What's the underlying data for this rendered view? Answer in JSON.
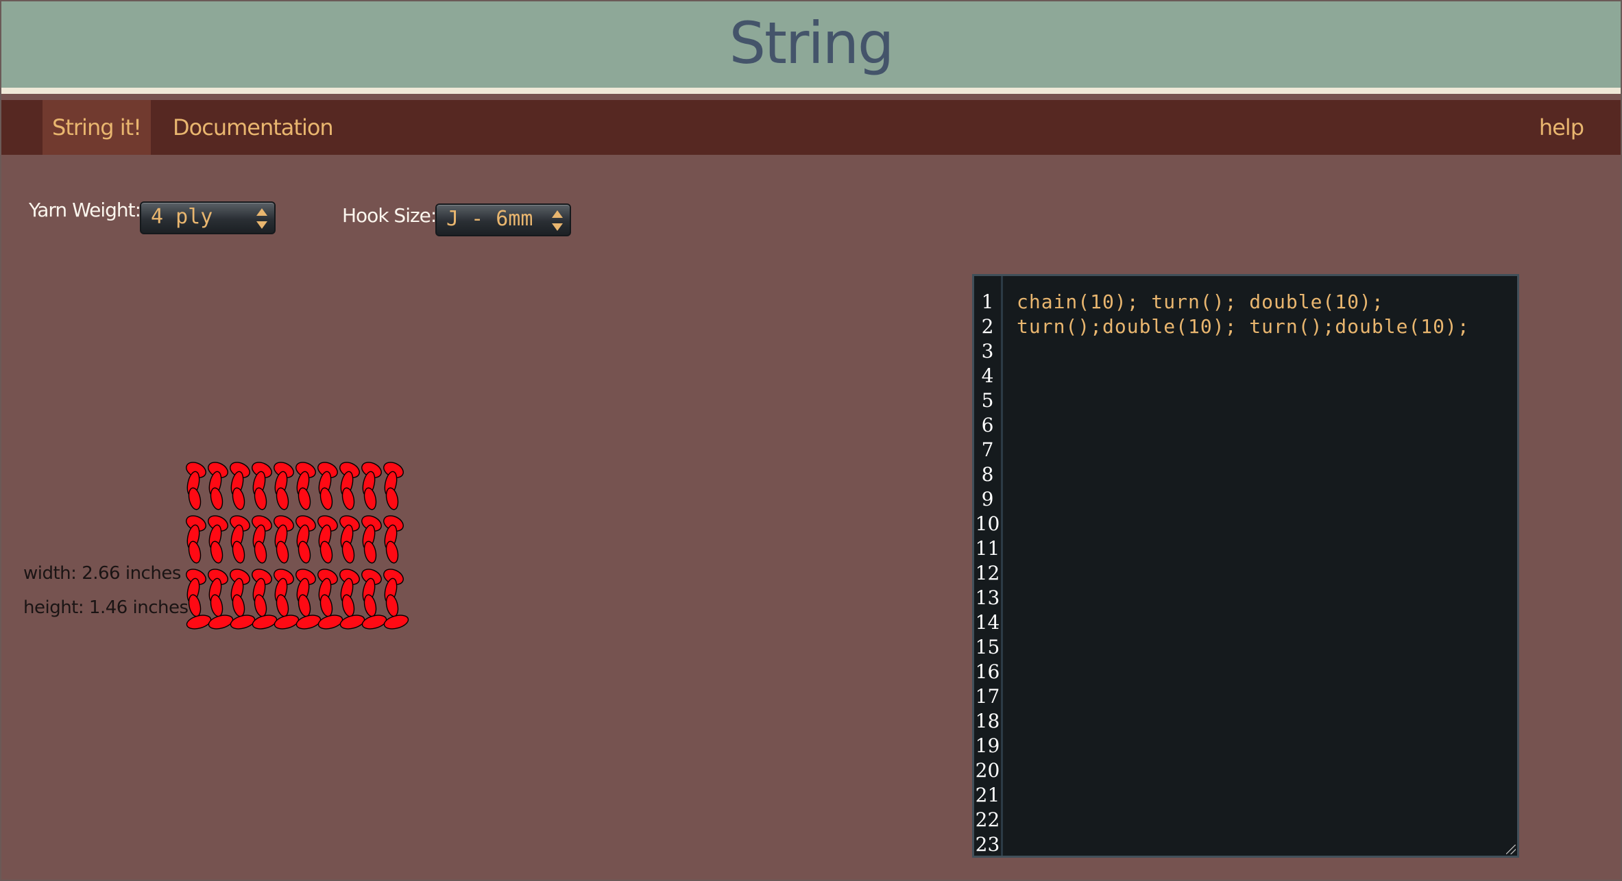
{
  "header": {
    "title": "String"
  },
  "nav": {
    "string_it": "String it!",
    "documentation": "Documentation",
    "help": "help"
  },
  "controls": {
    "yarn_weight_label": "Yarn Weight:",
    "yarn_weight_value": "4 ply",
    "hook_size_label": "Hook Size:",
    "hook_size_value": "J - 6mm"
  },
  "dimensions": {
    "width": "width: 2.66 inches",
    "height": "height: 1.46 inches"
  },
  "swatch": {
    "stitch_color": "#ff0a14",
    "outline_color": "#000000",
    "rows": 3,
    "stitches_per_row": 10
  },
  "editor": {
    "line_numbers": [
      "1",
      "2",
      "3",
      "4",
      "5",
      "6",
      "7",
      "8",
      "9",
      "10",
      "11",
      "12",
      "13",
      "14",
      "15",
      "16",
      "17",
      "18",
      "19",
      "20",
      "21",
      "22",
      "23"
    ],
    "lines": [
      "chain(10); turn(); double(10);",
      "turn();double(10); turn();double(10);"
    ]
  },
  "colors": {
    "header_bg": "#8ea898",
    "nav_bg": "#562822",
    "nav_active_bg": "#713a2f",
    "page_bg": "#765350",
    "accent_text": "#e9b66f",
    "title_text": "#44546a",
    "editor_bg": "#151a1d"
  }
}
